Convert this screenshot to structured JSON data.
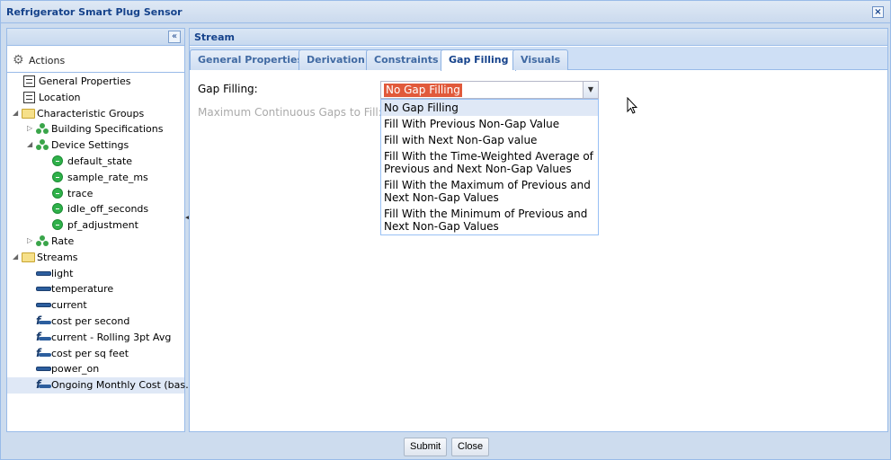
{
  "window": {
    "title": "Refrigerator Smart Plug Sensor",
    "close_icon": "×"
  },
  "left_panel": {
    "collapse_icon": "«",
    "actions_label": "Actions",
    "tree": [
      {
        "label": "General Properties",
        "icon": "document-icon",
        "depth": 1,
        "toggle": ""
      },
      {
        "label": "Location",
        "icon": "document-icon",
        "depth": 1,
        "toggle": ""
      },
      {
        "label": "Characteristic Groups",
        "icon": "folder-icon",
        "depth": 0,
        "toggle": "expanded"
      },
      {
        "label": "Building Specifications",
        "icon": "group-icon",
        "depth": 1,
        "toggle": "collapsed"
      },
      {
        "label": "Device Settings",
        "icon": "group-icon",
        "depth": 1,
        "toggle": "expanded"
      },
      {
        "label": "default_state",
        "icon": "characteristic-icon",
        "depth": 2,
        "toggle": ""
      },
      {
        "label": "sample_rate_ms",
        "icon": "characteristic-icon",
        "depth": 2,
        "toggle": ""
      },
      {
        "label": "trace",
        "icon": "characteristic-icon",
        "depth": 2,
        "toggle": ""
      },
      {
        "label": "idle_off_seconds",
        "icon": "characteristic-icon",
        "depth": 2,
        "toggle": ""
      },
      {
        "label": "pf_adjustment",
        "icon": "characteristic-icon",
        "depth": 2,
        "toggle": ""
      },
      {
        "label": "Rate",
        "icon": "group-icon",
        "depth": 1,
        "toggle": "collapsed"
      },
      {
        "label": "Streams",
        "icon": "folder-icon",
        "depth": 0,
        "toggle": "expanded"
      },
      {
        "label": "light",
        "icon": "stream-icon",
        "depth": 1,
        "toggle": ""
      },
      {
        "label": "temperature",
        "icon": "stream-icon",
        "depth": 1,
        "toggle": ""
      },
      {
        "label": "current",
        "icon": "stream-icon",
        "depth": 1,
        "toggle": ""
      },
      {
        "label": "cost per second",
        "icon": "derived-stream-icon",
        "depth": 1,
        "toggle": ""
      },
      {
        "label": "current - Rolling 3pt Avg",
        "icon": "derived-stream-icon",
        "depth": 1,
        "toggle": ""
      },
      {
        "label": "cost per sq feet",
        "icon": "derived-stream-icon",
        "depth": 1,
        "toggle": ""
      },
      {
        "label": "power_on",
        "icon": "stream-icon",
        "depth": 1,
        "toggle": ""
      },
      {
        "label": "Ongoing Monthly Cost (bas…",
        "icon": "derived-stream-icon",
        "depth": 1,
        "toggle": "",
        "selected": true
      }
    ]
  },
  "right_panel": {
    "title": "Stream",
    "tabs": [
      {
        "label": "General Properties",
        "active": false
      },
      {
        "label": "Derivation",
        "active": false
      },
      {
        "label": "Constraints",
        "active": false
      },
      {
        "label": "Gap Filling",
        "active": true
      },
      {
        "label": "Visuals",
        "active": false
      }
    ],
    "form": {
      "gap_filling_label": "Gap Filling:",
      "gap_filling_value": "No Gap Filling",
      "max_gaps_label": "Maximum Continuous Gaps to Fill:",
      "dropdown_options": [
        "No Gap Filling",
        "Fill With Previous Non-Gap Value",
        "Fill with Next Non-Gap value",
        "Fill With the Time-Weighted Average of Previous and Next Non-Gap Values",
        "Fill With the Maximum of Previous and Next Non-Gap Values",
        "Fill With the Minimum of Previous and Next Non-Gap Values"
      ],
      "selected_option_index": 0
    }
  },
  "footer": {
    "submit_label": "Submit",
    "close_label": "Close"
  },
  "colors": {
    "title_text": "#15428b",
    "panel_border": "#99bbe8",
    "window_bg": "#cddcee",
    "selection_highlight": "#e15a3b",
    "tree_selected": "#dfe8f6"
  }
}
